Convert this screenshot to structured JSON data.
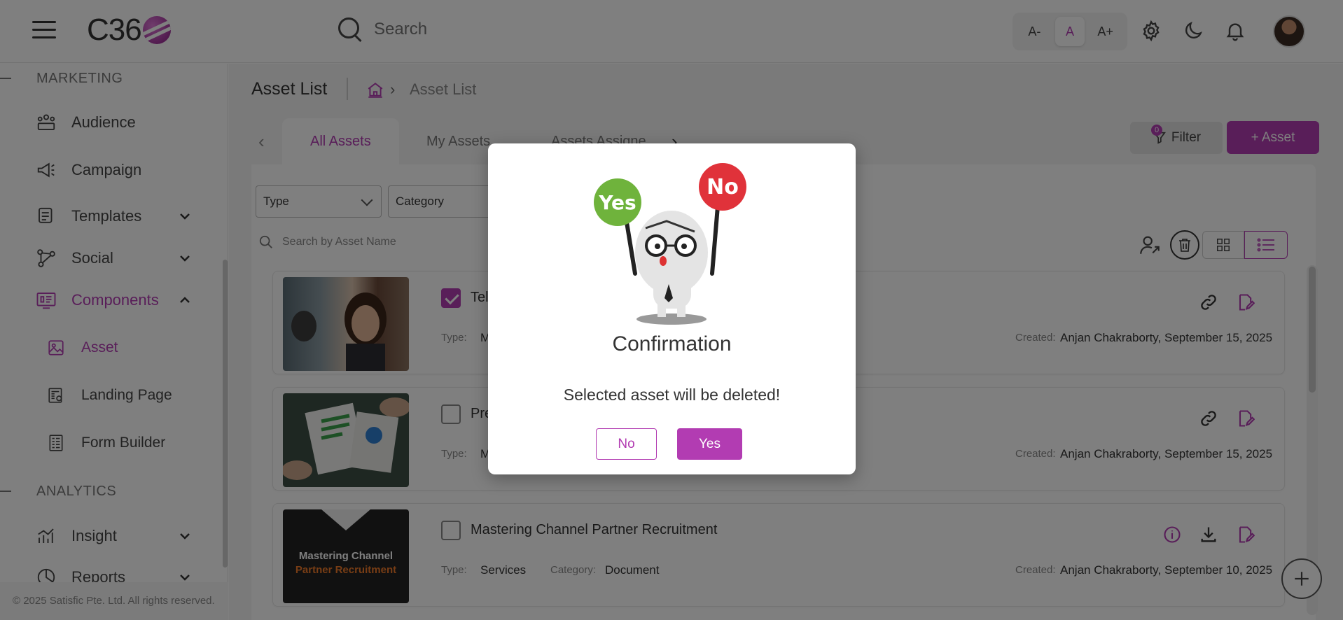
{
  "header": {
    "logo_text": "C36",
    "search_placeholder": "Search",
    "font_decrease": "A-",
    "font_normal": "A",
    "font_increase": "A+"
  },
  "sidebar": {
    "section_marketing": "MARKETING",
    "section_analytics": "ANALYTICS",
    "items": {
      "audience": "Audience",
      "campaign": "Campaign",
      "templates": "Templates",
      "social": "Social",
      "components": "Components",
      "asset": "Asset",
      "landing_page": "Landing Page",
      "form_builder": "Form Builder",
      "insight": "Insight",
      "reports": "Reports"
    },
    "footer": "© 2025 Satisfic Pte. Ltd. All rights reserved."
  },
  "main": {
    "page_title": "Asset List",
    "breadcrumb_current": "Asset List",
    "tabs": [
      "All Assets",
      "My Assets",
      "Assets Assigne"
    ],
    "filter_label": "Filter",
    "filter_count": "0",
    "add_asset_label": "+ Asset",
    "type_select": "Type",
    "category_select": "Category",
    "asset_search_placeholder": "Search by Asset Name"
  },
  "assets": [
    {
      "title": "Tel",
      "type_label": "Type:",
      "type_value": "M",
      "created_label": "Created:",
      "created_value": "Anjan Chakraborty, September 15, 2025",
      "checked": true
    },
    {
      "title": "Pre",
      "type_label": "Type:",
      "type_value": "M",
      "created_label": "Created:",
      "created_value": "Anjan Chakraborty, September 15, 2025",
      "checked": false
    },
    {
      "title": "Mastering Channel Partner Recruitment",
      "type_label": "Type:",
      "type_value": "Services",
      "category_label": "Category:",
      "category_value": "Document",
      "created_label": "Created:",
      "created_value": "Anjan Chakraborty, September 10, 2025",
      "checked": false,
      "thumb_line1": "Mastering Channel",
      "thumb_line2": "Partner Recruitment"
    }
  ],
  "modal": {
    "sign_yes": "Yes",
    "sign_no": "No",
    "title": "Confirmation",
    "message": "Selected asset will be deleted!",
    "no_label": "No",
    "yes_label": "Yes"
  },
  "colors": {
    "accent": "#b23cb2",
    "overlay": "rgba(0,0,0,0.5)"
  }
}
